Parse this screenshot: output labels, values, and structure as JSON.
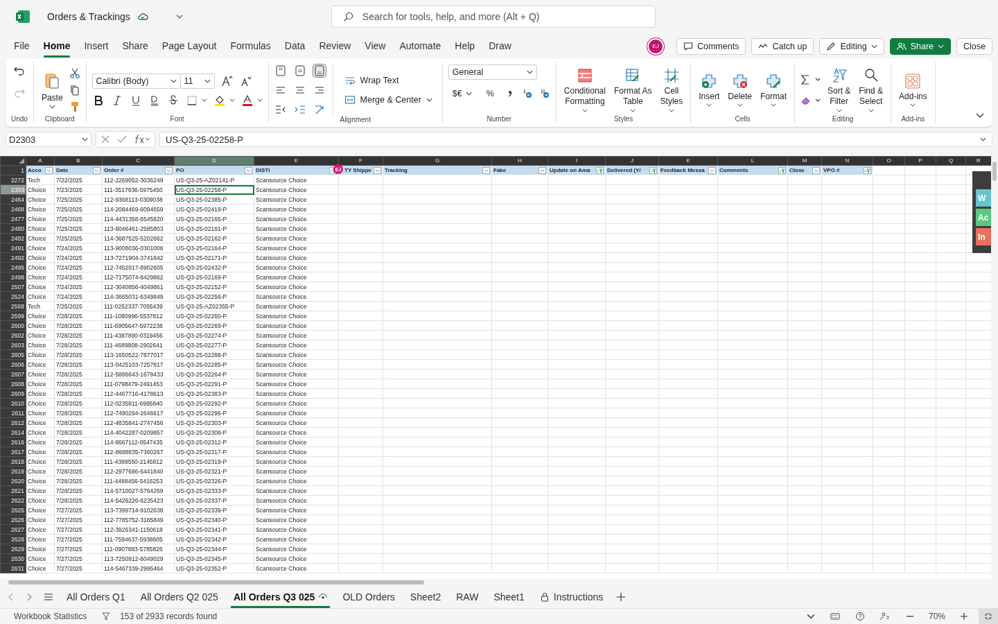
{
  "app": {
    "title": "Orders & Trackings",
    "search_placeholder": "Search for tools, help, and more (Alt + Q)"
  },
  "menu_tabs": [
    {
      "label": "File",
      "selected": false
    },
    {
      "label": "Home",
      "selected": true
    },
    {
      "label": "Insert",
      "selected": false
    },
    {
      "label": "Share",
      "selected": false
    },
    {
      "label": "Page Layout",
      "selected": false
    },
    {
      "label": "Formulas",
      "selected": false
    },
    {
      "label": "Data",
      "selected": false
    },
    {
      "label": "Review",
      "selected": false
    },
    {
      "label": "View",
      "selected": false
    },
    {
      "label": "Automate",
      "selected": false
    },
    {
      "label": "Help",
      "selected": false
    },
    {
      "label": "Draw",
      "selected": false
    }
  ],
  "user": {
    "initials": "EJ"
  },
  "actions": [
    {
      "label": "Comments",
      "kind": "comments"
    },
    {
      "label": "Catch up",
      "kind": "catchup"
    },
    {
      "label": "Editing",
      "kind": "editing"
    },
    {
      "label": "Share",
      "kind": "share"
    },
    {
      "label": "Close",
      "kind": "plain"
    }
  ],
  "ribbon": {
    "undo": {
      "label": "Undo",
      "redo_disabled": true
    },
    "clipboard": {
      "label": "Clipboard",
      "paste": "Paste"
    },
    "font": {
      "label": "Font",
      "family": "Calibri (Body)",
      "size": "11"
    },
    "alignment": {
      "label": "Alignment",
      "wrap": "Wrap Text",
      "merge": "Merge & Center"
    },
    "number": {
      "label": "Number",
      "format": "General",
      "currency": "$€",
      "percent": "%"
    },
    "styles": {
      "label": "Styles",
      "buttons": [
        {
          "lines": [
            "Conditional",
            "Formatting"
          ]
        },
        {
          "lines": [
            "Format As",
            "Table"
          ]
        },
        {
          "lines": [
            "Cell",
            "Styles"
          ]
        }
      ]
    },
    "cells": {
      "label": "Cells",
      "buttons": [
        {
          "label": "Insert",
          "kind": "insert"
        },
        {
          "label": "Delete",
          "kind": "delete"
        },
        {
          "label": "Format",
          "kind": "format"
        }
      ]
    },
    "editing": {
      "label": "Editing",
      "buttons": [
        {
          "lines": [
            "Sort &",
            "Filter"
          ],
          "kind": "sort"
        },
        {
          "lines": [
            "Find &",
            "Select"
          ],
          "kind": "find"
        }
      ]
    },
    "addins": {
      "label": "Add-ins",
      "button": "Add-ins"
    }
  },
  "formula_bar": {
    "name_box": "D2303",
    "formula": "US-Q3-25-02258-P"
  },
  "grid": {
    "columns": [
      {
        "letter": "A",
        "header": "Acco",
        "filtered": false,
        "selected": false
      },
      {
        "letter": "B",
        "header": "Date",
        "filtered": false,
        "selected": false
      },
      {
        "letter": "C",
        "header": "Order #",
        "filtered": false,
        "selected": false
      },
      {
        "letter": "D",
        "header": "PO",
        "filtered": false,
        "selected": true
      },
      {
        "letter": "E",
        "header": "DISTI",
        "filtered": true,
        "selected": false
      },
      {
        "letter": "F",
        "header": "TY Shippe",
        "filtered": false,
        "selected": false
      },
      {
        "letter": "G",
        "header": "Tracking",
        "filtered": false,
        "selected": false
      },
      {
        "letter": "H",
        "header": "Fake",
        "filtered": false,
        "selected": false
      },
      {
        "letter": "I",
        "header": "Update on Ama",
        "filtered": true,
        "selected": false
      },
      {
        "letter": "J",
        "header": "Delivered (Y/",
        "filtered": true,
        "selected": false
      },
      {
        "letter": "K",
        "header": "Feedback Messa",
        "filtered": false,
        "selected": false
      },
      {
        "letter": "L",
        "header": "Comments",
        "filtered": true,
        "selected": false
      },
      {
        "letter": "M",
        "header": "Close",
        "filtered": false,
        "selected": false
      },
      {
        "letter": "N",
        "header": "VPO #",
        "filtered": true,
        "selected": false
      },
      {
        "letter": "O",
        "selected": false
      },
      {
        "letter": "P",
        "selected": false
      },
      {
        "letter": "Q",
        "selected": false
      },
      {
        "letter": "R",
        "selected": false
      }
    ],
    "header_row": "1",
    "presence": {
      "initials": "EJ"
    },
    "rows": [
      {
        "num": "2272",
        "selected": false,
        "cells": [
          "Tech",
          "7/22/2025",
          "112-2269052-3036249",
          "US-Q3-25-AZ02141-P",
          "Scansource Choice"
        ]
      },
      {
        "num": "2303",
        "selected": true,
        "cells": [
          "Choice",
          "7/23/2025",
          "111-3517936-5975450",
          "US-Q3-25-02258-P",
          "Scansource Choice"
        ]
      },
      {
        "num": "2464",
        "selected": false,
        "cells": [
          "Choice",
          "7/25/2025",
          "112-9368113-0309038",
          "US-Q3-25-02385-P",
          "Scansource Choice"
        ]
      },
      {
        "num": "2468",
        "selected": false,
        "cells": [
          "Choice",
          "7/25/2025",
          "114-2084469-6094659",
          "US-Q3-25-02419-P",
          "Scansource Choice"
        ]
      },
      {
        "num": "2477",
        "selected": false,
        "cells": [
          "Choice",
          "7/25/2025",
          "114-4431358-6545820",
          "US-Q3-25-02165-P",
          "Scansource Choice"
        ]
      },
      {
        "num": "2480",
        "selected": false,
        "cells": [
          "Choice",
          "7/25/2025",
          "113-8046461-2585803",
          "US-Q3-25-02191-P",
          "Scansource Choice"
        ]
      },
      {
        "num": "2482",
        "selected": false,
        "cells": [
          "Choice",
          "7/25/2025",
          "114-3687525-5202662",
          "US-Q3-25-02162-P",
          "Scansource Choice"
        ]
      },
      {
        "num": "2491",
        "selected": false,
        "cells": [
          "Choice",
          "7/24/2025",
          "113-9008036-0301006",
          "US-Q3-25-02164-P",
          "Scansource Choice"
        ]
      },
      {
        "num": "2492",
        "selected": false,
        "cells": [
          "Choice",
          "7/24/2025",
          "113-7271904-3741842",
          "US-Q3-25-02171-P",
          "Scansource Choice"
        ]
      },
      {
        "num": "2495",
        "selected": false,
        "cells": [
          "Choice",
          "7/24/2025",
          "112-7452917-8902605",
          "US-Q3-25-02432-P",
          "Scansource Choice"
        ]
      },
      {
        "num": "2498",
        "selected": false,
        "cells": [
          "Choice",
          "7/24/2025",
          "112-7175074-8429862",
          "US-Q3-25-02169-P",
          "Scansource Choice"
        ]
      },
      {
        "num": "2507",
        "selected": false,
        "cells": [
          "Choice",
          "7/24/2025",
          "112-3040856-4049861",
          "US-Q3-25-02152-P",
          "Scansource Choice"
        ]
      },
      {
        "num": "2524",
        "selected": false,
        "cells": [
          "Choice",
          "7/24/2025",
          "114-3665031-6349849",
          "US-Q3-25-02256-P",
          "Scansource Choice"
        ]
      },
      {
        "num": "2568",
        "selected": false,
        "cells": [
          "Tech",
          "7/25/2025",
          "111-0252337-7055439",
          "US-Q3-25-AZ02355-P",
          "Scansource Choice"
        ]
      },
      {
        "num": "2599",
        "selected": false,
        "cells": [
          "Choice",
          "7/28/2025",
          "111-1080996-5537812",
          "US-Q3-25-02260-P",
          "Scansource Choice"
        ]
      },
      {
        "num": "2600",
        "selected": false,
        "cells": [
          "Choice",
          "7/28/2025",
          "111-6905647-5972238",
          "US-Q3-25-02269-P",
          "Scansource Choice"
        ]
      },
      {
        "num": "2602",
        "selected": false,
        "cells": [
          "Choice",
          "7/28/2025",
          "111-4387890-0319456",
          "US-Q3-25-02274-P",
          "Scansource Choice"
        ]
      },
      {
        "num": "2603",
        "selected": false,
        "cells": [
          "Choice",
          "7/28/2025",
          "111-4689808-2902641",
          "US-Q3-25-02277-P",
          "Scansource Choice"
        ]
      },
      {
        "num": "2605",
        "selected": false,
        "cells": [
          "Choice",
          "7/28/2025",
          "113-1650522-7877017",
          "US-Q3-25-02288-P",
          "Scansource Choice"
        ]
      },
      {
        "num": "2606",
        "selected": false,
        "cells": [
          "Choice",
          "7/28/2025",
          "113-0425103-7257817",
          "US-Q3-25-02285-P",
          "Scansource Choice"
        ]
      },
      {
        "num": "2607",
        "selected": false,
        "cells": [
          "Choice",
          "7/28/2025",
          "112-5886643-1679433",
          "US-Q3-25-02264-P",
          "Scansource Choice"
        ]
      },
      {
        "num": "2608",
        "selected": false,
        "cells": [
          "Choice",
          "7/28/2025",
          "111-0798479-2491453",
          "US-Q3-25-02291-P",
          "Scansource Choice"
        ]
      },
      {
        "num": "2609",
        "selected": false,
        "cells": [
          "Choice",
          "7/28/2025",
          "112-4467716-4178613",
          "US-Q3-25-02383-P",
          "Scansource Choice"
        ]
      },
      {
        "num": "2610",
        "selected": false,
        "cells": [
          "Choice",
          "7/28/2025",
          "112-0235811-6985840",
          "US-Q3-25-02292-P",
          "Scansource Choice"
        ]
      },
      {
        "num": "2611",
        "selected": false,
        "cells": [
          "Choice",
          "7/28/2025",
          "112-7490294-2646617",
          "US-Q3-25-02296-P",
          "Scansource Choice"
        ]
      },
      {
        "num": "2612",
        "selected": false,
        "cells": [
          "Choice",
          "7/28/2025",
          "112-4835841-2747456",
          "US-Q3-25-02303-P",
          "Scansource Choice"
        ]
      },
      {
        "num": "2614",
        "selected": false,
        "cells": [
          "Choice",
          "7/28/2025",
          "114-4042287-0209857",
          "US-Q3-25-02308-P",
          "Scansource Choice"
        ]
      },
      {
        "num": "2616",
        "selected": false,
        "cells": [
          "Choice",
          "7/28/2025",
          "114-8667112-0547435",
          "US-Q3-25-02312-P",
          "Scansource Choice"
        ]
      },
      {
        "num": "2617",
        "selected": false,
        "cells": [
          "Choice",
          "7/28/2025",
          "112-8688835-7360267",
          "US-Q3-25-02317-P",
          "Scansource Choice"
        ]
      },
      {
        "num": "2618",
        "selected": false,
        "cells": [
          "Choice",
          "7/28/2025",
          "111-4389550-2145812",
          "US-Q3-25-02319-P",
          "Scansource Choice"
        ]
      },
      {
        "num": "2619",
        "selected": false,
        "cells": [
          "Choice",
          "7/28/2025",
          "112-2977686-6441840",
          "US-Q3-25-02321-P",
          "Scansource Choice"
        ]
      },
      {
        "num": "2620",
        "selected": false,
        "cells": [
          "Choice",
          "7/28/2025",
          "111-4488456-5416253",
          "US-Q3-25-02326-P",
          "Scansource Choice"
        ]
      },
      {
        "num": "2621",
        "selected": false,
        "cells": [
          "Choice",
          "7/28/2025",
          "114-5710027-5764269",
          "US-Q3-25-02333-P",
          "Scansource Choice"
        ]
      },
      {
        "num": "2622",
        "selected": false,
        "cells": [
          "Choice",
          "7/28/2025",
          "114-5426226-6235423",
          "US-Q3-25-02337-P",
          "Scansource Choice"
        ]
      },
      {
        "num": "2625",
        "selected": false,
        "cells": [
          "Choice",
          "7/27/2025",
          "113-7399714-9102638",
          "US-Q3-25-02339-P",
          "Scansource Choice"
        ]
      },
      {
        "num": "2626",
        "selected": false,
        "cells": [
          "Choice",
          "7/27/2025",
          "112-7785752-3185849",
          "US-Q3-25-02340-P",
          "Scansource Choice"
        ]
      },
      {
        "num": "2627",
        "selected": false,
        "cells": [
          "Choice",
          "7/27/2025",
          "112-3926341-1150618",
          "US-Q3-25-02341-P",
          "Scansource Choice"
        ]
      },
      {
        "num": "2628",
        "selected": false,
        "cells": [
          "Choice",
          "7/27/2025",
          "111-7594637-5938605",
          "US-Q3-25-02342-P",
          "Scansource Choice"
        ]
      },
      {
        "num": "2629",
        "selected": false,
        "cells": [
          "Choice",
          "7/27/2025",
          "111-0907883-5785826",
          "US-Q3-25-02344-P",
          "Scansource Choice"
        ]
      },
      {
        "num": "2630",
        "selected": false,
        "cells": [
          "Choice",
          "7/27/2025",
          "113-7250912-6049029",
          "US-Q3-25-02345-P",
          "Scansource Choice"
        ]
      },
      {
        "num": "2631",
        "selected": false,
        "cells": [
          "Choice",
          "7/27/2025",
          "114-5467339-2995464",
          "US-Q3-25-02352-P",
          "Scansource Choice"
        ]
      }
    ]
  },
  "side_panel_tabs": [
    {
      "label": "W",
      "color": "#67c4cf"
    },
    {
      "label": "Ac",
      "color": "#5cc77e"
    },
    {
      "label": "In",
      "color": "#e8705f"
    }
  ],
  "sheet_tabs": [
    {
      "label": "All Orders Q1",
      "selected": false,
      "kind": "plain"
    },
    {
      "label": "All Orders Q2 025",
      "selected": false,
      "kind": "plain"
    },
    {
      "label": "All Orders Q3 025",
      "selected": true,
      "kind": "viewed"
    },
    {
      "label": "OLD Orders",
      "selected": false,
      "kind": "plain"
    },
    {
      "label": "Sheet2",
      "selected": false,
      "kind": "plain"
    },
    {
      "label": "RAW",
      "selected": false,
      "kind": "plain"
    },
    {
      "label": "Sheet1",
      "selected": false,
      "kind": "plain"
    },
    {
      "label": "Instructions",
      "selected": false,
      "kind": "locked"
    }
  ],
  "status_bar": {
    "statistics": "Workbook Statistics",
    "records": "153 of 2933 records found",
    "zoom": "70%"
  }
}
